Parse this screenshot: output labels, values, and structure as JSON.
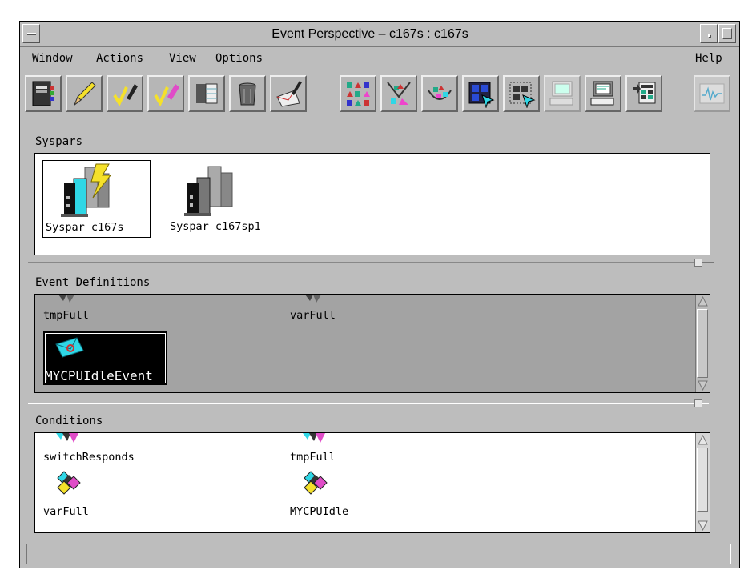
{
  "window": {
    "title": "Event Perspective – c167s : c167s"
  },
  "menubar": {
    "items": [
      "Window",
      "Actions",
      "View",
      "Options"
    ],
    "help": "Help"
  },
  "toolbar": {
    "tools": [
      {
        "icon": "notebook-icon",
        "enabled": true
      },
      {
        "icon": "pencil-icon",
        "enabled": true
      },
      {
        "icon": "pencil-check-icon",
        "enabled": true
      },
      {
        "icon": "eraser-check-icon",
        "enabled": true
      },
      {
        "icon": "table-icon",
        "enabled": true
      },
      {
        "icon": "trash-can-icon",
        "enabled": true
      },
      {
        "icon": "envelope-pencil-icon",
        "enabled": true
      },
      {
        "icon": "shapes-grid-icon",
        "enabled": true
      },
      {
        "icon": "funnel-shapes-icon",
        "enabled": true
      },
      {
        "icon": "bowl-shapes-icon",
        "enabled": true
      },
      {
        "icon": "grid-select-icon",
        "enabled": true
      },
      {
        "icon": "dotted-grid-select-icon",
        "enabled": true
      },
      {
        "icon": "monitor-keyboard-disabled-icon",
        "enabled": false
      },
      {
        "icon": "monitor-keyboard-icon",
        "enabled": true
      },
      {
        "icon": "spreadsheet-arrows-icon",
        "enabled": true
      },
      {
        "icon": "waveform-icon",
        "enabled": false
      }
    ]
  },
  "syspars": {
    "label": "Syspars",
    "items": [
      {
        "label": "Syspar c167s",
        "icon": "syspar-active-icon",
        "selected": true
      },
      {
        "label": "Syspar c167sp1",
        "icon": "syspar-icon",
        "selected": false
      }
    ]
  },
  "event_definitions": {
    "label": "Event Definitions",
    "items": [
      {
        "label": "tmpFull",
        "icon": "event-definition-icon",
        "selected": false
      },
      {
        "label": "varFull",
        "icon": "event-definition-icon",
        "selected": false
      },
      {
        "label": "MYCPUIdleEvent",
        "icon": "event-envelope-icon",
        "selected": true
      }
    ]
  },
  "conditions": {
    "label": "Conditions",
    "items": [
      {
        "label": "switchResponds",
        "icon": "condition-icon"
      },
      {
        "label": "tmpFull",
        "icon": "condition-icon"
      },
      {
        "label": "varFull",
        "icon": "condition-icon"
      },
      {
        "label": "MYCPUIdle",
        "icon": "condition-icon"
      }
    ]
  },
  "colors": {
    "window_bg": "#bdbdbd",
    "pane_gray": "#a3a3a3",
    "selection": "#000000",
    "accent_cyan": "#2fd7e6",
    "accent_yellow": "#f5e12a"
  }
}
